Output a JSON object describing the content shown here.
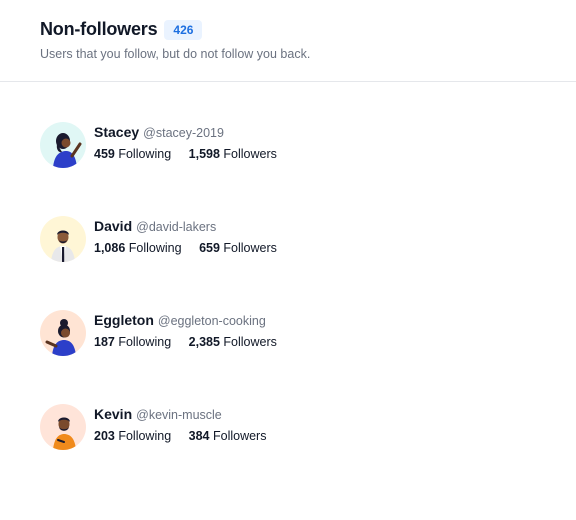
{
  "header": {
    "title": "Non-followers",
    "count": "426",
    "subtitle": "Users that you follow, but do not follow you back."
  },
  "users": [
    {
      "name": "Stacey",
      "handle": "@stacey-2019",
      "following": "459",
      "following_label": "Following",
      "followers": "1,598",
      "followers_label": "Followers",
      "avatar_bg": "#e0f7f5",
      "avatar_icon": "woman-waving-avatar"
    },
    {
      "name": "David",
      "handle": "@david-lakers",
      "following": "1,086",
      "following_label": "Following",
      "followers": "659",
      "followers_label": "Followers",
      "avatar_bg": "#fff6d6",
      "avatar_icon": "man-suit-avatar"
    },
    {
      "name": "Eggleton",
      "handle": "@eggleton-cooking",
      "following": "187",
      "following_label": "Following",
      "followers": "2,385",
      "followers_label": "Followers",
      "avatar_bg": "#ffe4d4",
      "avatar_icon": "woman-bun-avatar"
    },
    {
      "name": "Kevin",
      "handle": "@kevin-muscle",
      "following": "203",
      "following_label": "Following",
      "followers": "384",
      "followers_label": "Followers",
      "avatar_bg": "#ffe4d9",
      "avatar_icon": "man-orange-shirt-avatar"
    }
  ]
}
